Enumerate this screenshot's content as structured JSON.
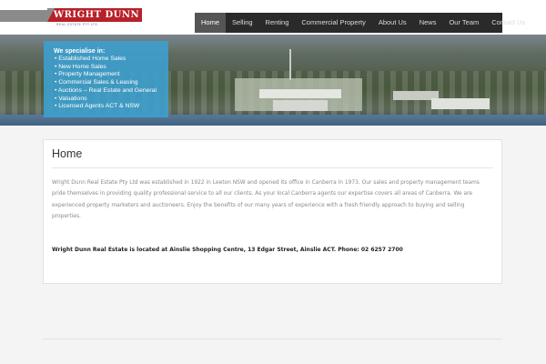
{
  "logo": {
    "name": "WRIGHT DUNN",
    "subtitle": "REAL ESTATE PTY LTD",
    "colors": {
      "red": "#b8202a",
      "gray": "#8a8a8a"
    }
  },
  "nav": {
    "items": [
      {
        "label": "Home",
        "active": true
      },
      {
        "label": "Selling",
        "active": false
      },
      {
        "label": "Renting",
        "active": false
      },
      {
        "label": "Commercial Property",
        "active": false
      },
      {
        "label": "About Us",
        "active": false
      },
      {
        "label": "News",
        "active": false
      },
      {
        "label": "Our Team",
        "active": false
      },
      {
        "label": "Contact Us",
        "active": false
      }
    ]
  },
  "specialise": {
    "title": "We specialise in:",
    "items": [
      "• Established Home Sales",
      "• New Home Sales",
      "• Property Management",
      "• Commercial Sales & Leasing",
      "• Auctions – Real Estate and General",
      "• Valuations",
      "• Licensed Agents ACT & NSW"
    ]
  },
  "content": {
    "title": "Home",
    "body_lines": [
      "Wright Dunn Real Estate Pty Ltd was established in 1922 in Leeton NSW and opened its office in Canberra in 1973.  Our sales and property management teams",
      "pride themselves in providing quality professional service to all our clients.  As your local Canberra agents our expertise covers all areas of Canberra.  We are",
      "experienced property marketers and auctioneers. Enjoy the benefits of our many years of experience with a fresh friendly approach to buying and selling",
      "properties."
    ],
    "address": "Wright Dunn Real Estate is located at Ainslie Shopping Centre, 13 Edgar Street, Ainslie ACT.  Phone:  02 6257 2700"
  }
}
